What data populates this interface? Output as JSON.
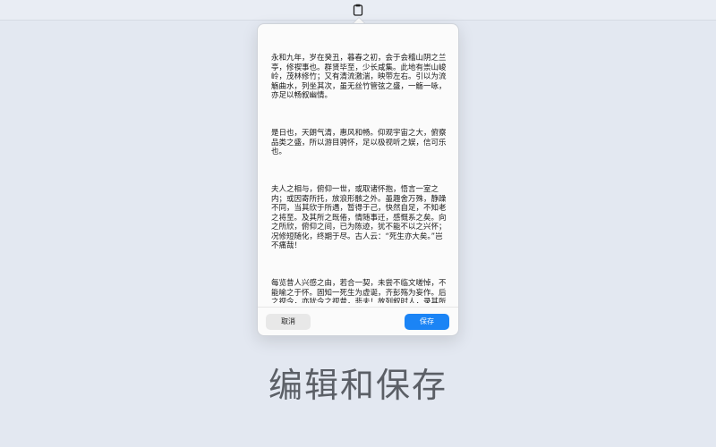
{
  "menubar": {
    "icon": "clipboard-icon"
  },
  "editor": {
    "paragraphs": [
      "永和九年，岁在癸丑，暮春之初，会于会稽山阴之兰亭，修禊事也。群贤毕至，少长咸集。此地有崇山峻岭，茂林修竹；又有清流激湍，映带左右。引以为流觞曲水，列坐其次，虽无丝竹管弦之盛，一觞一咏，亦足以畅叙幽情。",
      "是日也，天朗气清，惠风和畅。仰观宇宙之大，俯察品类之盛，所以游目骋怀，足以极视听之娱，信可乐也。",
      "夫人之相与，俯仰一世，或取诸怀抱，悟言一室之内；或因寄所托，放浪形骸之外。虽趣舍万殊，静躁不同，当其欣于所遇，暂得于己，快然自足，不知老之将至。及其所之既倦，情随事迁，感慨系之矣。向之所欣，俯仰之间，已为陈迹，犹不能不以之兴怀；况修短随化，终期于尽。古人云：“死生亦大矣。”岂不痛哉！",
      "每览昔人兴感之由，若合一契，未尝不临文嗟悼，不能喻之于怀。固知一死生为虚诞，齐彭殇为妄作。后之视今，亦犹今之视昔，悲夫！故列叙时人，录其所述，虽世殊事异，所以兴怀，其致一也。后之览者，亦将有感于斯文。"
    ]
  },
  "buttons": {
    "cancel_label": "取消",
    "save_label": "保存"
  },
  "caption": {
    "text": "编辑和保存"
  },
  "colors": {
    "accent": "#1b84f5",
    "background": "#e3e8f1"
  }
}
